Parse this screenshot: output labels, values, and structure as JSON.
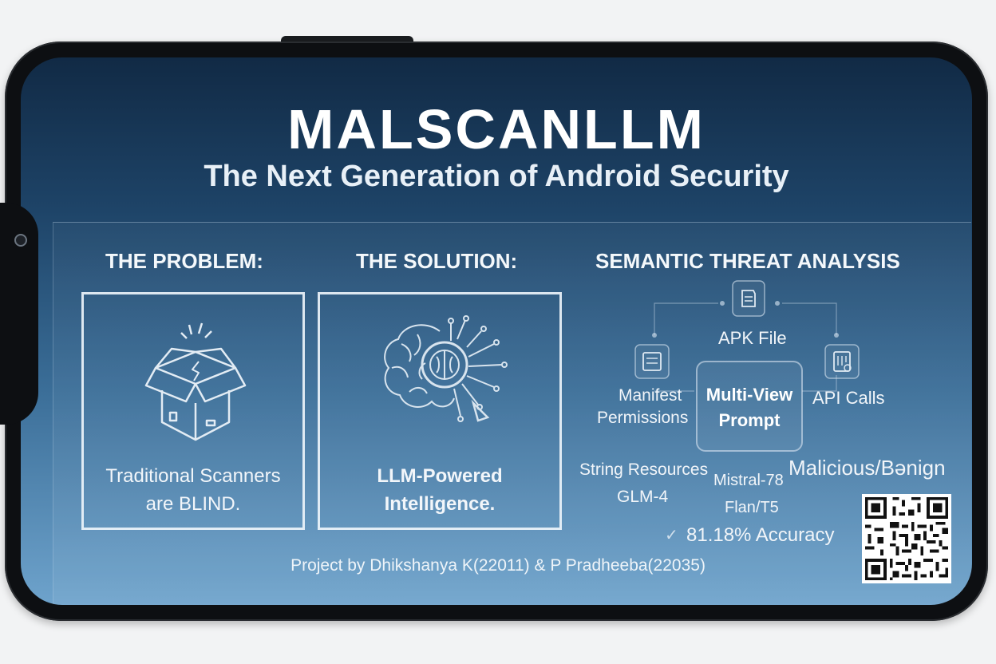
{
  "header": {
    "title": "MALSCANLLM",
    "subtitle": "The Next Generation of Android Security"
  },
  "sections": {
    "problem": {
      "heading": "THE PROBLEM:",
      "line1": "Traditional Scanners",
      "line2": "are BLIND."
    },
    "solution": {
      "heading": "THE SOLUTION:",
      "line1": "LLM-Powered",
      "line2": "Intelligence."
    },
    "analysis": {
      "heading": "SEMANTIC THREAT ANALYSIS",
      "apk_file": "APK File",
      "manifest_line1": "Manifest",
      "manifest_line2": "Permissions",
      "api_calls": "API Calls",
      "prompt_line1": "Multi-View",
      "prompt_line2": "Prompt",
      "string_resources": "String Resources",
      "glm": "GLM-4",
      "mistral": "Mistral-78",
      "flan": "Flan/T5",
      "result": "Malicious/Bənign",
      "accuracy": "81.18% Accuracy"
    }
  },
  "footer": {
    "credits": "Project by Dhikshanya K(22011) & P Pradheeba(22035)"
  },
  "icons": {
    "problem": "broken-box-icon",
    "solution": "brain-circuit-icon",
    "apk": "document-icon",
    "manifest": "manifest-icon",
    "api": "api-icon",
    "check": "check-icon",
    "qr": "qr-code-icon"
  },
  "colors": {
    "background_top": "#112a45",
    "background_bottom": "#6ea3cc",
    "text": "#ffffff"
  }
}
